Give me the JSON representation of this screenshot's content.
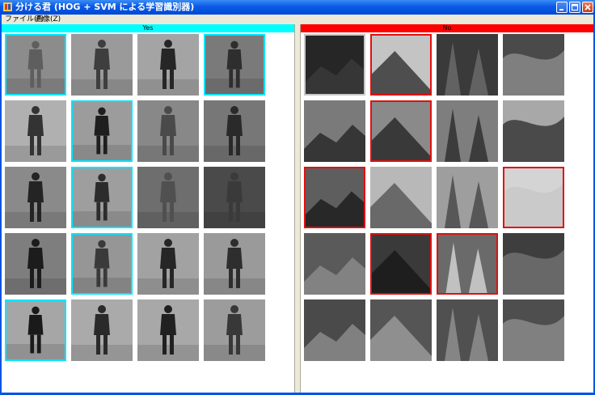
{
  "window": {
    "title": "分ける君 (HOG + SVM による学習識別器)",
    "controls": [
      "minimize-icon",
      "maximize-icon",
      "close-icon"
    ]
  },
  "menu": [
    "ファイル(F)",
    "画像(Z)"
  ],
  "panels": {
    "yes": {
      "label": "Yes",
      "header_color": "#00ffff",
      "rows": [
        [
          {
            "tone": "#8c8c8c",
            "shade": "#5e5e5e",
            "selected": true
          },
          {
            "tone": "#9a9a9a",
            "shade": "#3e3e3e",
            "selected": false
          },
          {
            "tone": "#a4a4a4",
            "shade": "#262626",
            "selected": false
          },
          {
            "tone": "#7a7a7a",
            "shade": "#2e2e2e",
            "selected": true
          }
        ],
        [
          {
            "tone": "#b0b0b0",
            "shade": "#333333",
            "selected": false
          },
          {
            "tone": "#9c9c9c",
            "shade": "#1e1e1e",
            "selected": true
          },
          {
            "tone": "#888888",
            "shade": "#4a4a4a",
            "selected": false
          },
          {
            "tone": "#777777",
            "shade": "#2a2a2a",
            "selected": false
          }
        ],
        [
          {
            "tone": "#8a8a8a",
            "shade": "#242424",
            "selected": false
          },
          {
            "tone": "#9e9e9e",
            "shade": "#2c2c2c",
            "selected": true
          },
          {
            "tone": "#6e6e6e",
            "shade": "#505050",
            "selected": false
          },
          {
            "tone": "#4a4a4a",
            "shade": "#3a3a3a",
            "selected": false
          }
        ],
        [
          {
            "tone": "#7e7e7e",
            "shade": "#1c1c1c",
            "selected": false
          },
          {
            "tone": "#969696",
            "shade": "#3a3a3a",
            "selected": true
          },
          {
            "tone": "#a2a2a2",
            "shade": "#262626",
            "selected": false
          },
          {
            "tone": "#9a9a9a",
            "shade": "#2e2e2e",
            "selected": false
          }
        ],
        [
          {
            "tone": "#a6a6a6",
            "shade": "#1a1a1a",
            "selected": true
          },
          {
            "tone": "#aaaaaa",
            "shade": "#2a2a2a",
            "selected": false
          },
          {
            "tone": "#a8a8a8",
            "shade": "#202020",
            "selected": false
          },
          {
            "tone": "#9c9c9c",
            "shade": "#383838",
            "selected": false
          }
        ]
      ]
    },
    "no": {
      "label": "No",
      "header_color": "#ff0000",
      "rows": [
        [
          {
            "tone": "#262626",
            "shade": "#3a3a3a",
            "selected": "gray"
          },
          {
            "tone": "#c4c4c4",
            "shade": "#3a3a3a",
            "selected": "red"
          },
          {
            "tone": "#3a3a3a",
            "shade": "#6a6a6a",
            "selected": false
          },
          {
            "tone": "#4a4a4a",
            "shade": "#888888",
            "selected": false
          }
        ],
        [
          {
            "tone": "#7a7a7a",
            "shade": "#2a2a2a",
            "selected": false
          },
          {
            "tone": "#8a8a8a",
            "shade": "#2a2a2a",
            "selected": "red"
          },
          {
            "tone": "#7e7e7e",
            "shade": "#303030",
            "selected": false
          },
          {
            "tone": "#a8a8a8",
            "shade": "#3a3a3a",
            "selected": false
          }
        ],
        [
          {
            "tone": "#5e5e5e",
            "shade": "#1e1e1e",
            "selected": "red"
          },
          {
            "tone": "#b8b8b8",
            "shade": "#5a5a5a",
            "selected": false
          },
          {
            "tone": "#9e9e9e",
            "shade": "#4a4a4a",
            "selected": false
          },
          {
            "tone": "#d4d4d4",
            "shade": "#c8c8c8",
            "selected": "red"
          }
        ],
        [
          {
            "tone": "#5a5a5a",
            "shade": "#8a8a8a",
            "selected": false
          },
          {
            "tone": "#3a3a3a",
            "shade": "#1a1a1a",
            "selected": "red"
          },
          {
            "tone": "#6a6a6a",
            "shade": "#d0d0d0",
            "selected": "red"
          },
          {
            "tone": "#3e3e3e",
            "shade": "#707070",
            "selected": false
          }
        ],
        [
          {
            "tone": "#4a4a4a",
            "shade": "#8a8a8a",
            "selected": false
          },
          {
            "tone": "#555555",
            "shade": "#9a9a9a",
            "selected": false
          },
          {
            "tone": "#505050",
            "shade": "#8e8e8e",
            "selected": false
          },
          {
            "tone": "#4e4e4e",
            "shade": "#8a8a8a",
            "selected": false
          }
        ]
      ]
    }
  }
}
